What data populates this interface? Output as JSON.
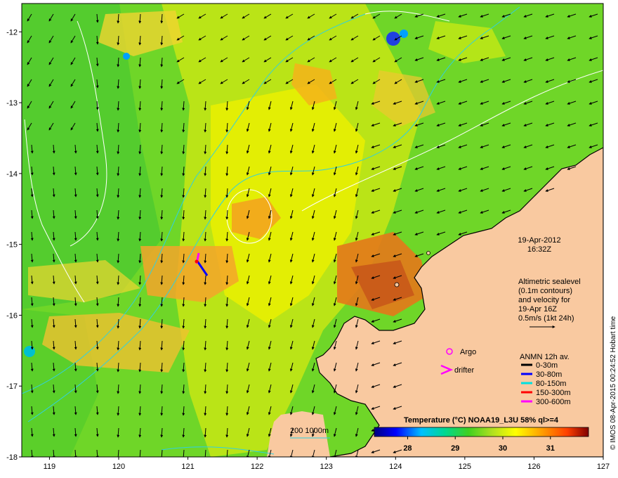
{
  "map": {
    "lon_range": [
      118.6,
      127
    ],
    "lat_range": [
      -18,
      -11.6
    ],
    "lon_ticks": [
      "119",
      "120",
      "121",
      "122",
      "123",
      "124",
      "125",
      "126",
      "127"
    ],
    "lat_ticks": [
      "-12",
      "-13",
      "-14",
      "-15",
      "-16",
      "-17",
      "-18"
    ]
  },
  "annotation": {
    "date": "19-Apr-2012",
    "time": "16:32Z",
    "altimetry_lines": [
      "Altimetric sealevel",
      "(0.1m contours)",
      "and velocity for",
      "19-Apr 16Z",
      "0.5m/s (1kt 24h)"
    ]
  },
  "legend": {
    "argo_label": "Argo",
    "drifter_label": "drifter",
    "anmn_title": "ANMN 12h av.",
    "anmn_items": [
      {
        "label": "0-30m",
        "color": "#000000"
      },
      {
        "label": "30-80m",
        "color": "#0000ff"
      },
      {
        "label": "80-150m",
        "color": "#00e0e0"
      },
      {
        "label": "150-300m",
        "color": "#ff0000"
      },
      {
        "label": "300-600m",
        "color": "#ff00ff"
      }
    ],
    "isobath_label": "200  1000m"
  },
  "colorbar": {
    "title": "Temperature (°C) NOAA19_L3U 58% ql>=4",
    "tick_labels": [
      "28",
      "29",
      "30",
      "31"
    ],
    "range": [
      27.3,
      31.8
    ],
    "stops": [
      "#000080",
      "#0000ff",
      "#00c0ff",
      "#00d890",
      "#40d020",
      "#b0e020",
      "#ffff00",
      "#ffa000",
      "#ff4000",
      "#800000"
    ]
  },
  "credit": "© IMOS 08-Apr-2015 00:24:52 Hobart time",
  "colors": {
    "land": "#f9c9a0",
    "ocean_base": "#6fd628"
  }
}
